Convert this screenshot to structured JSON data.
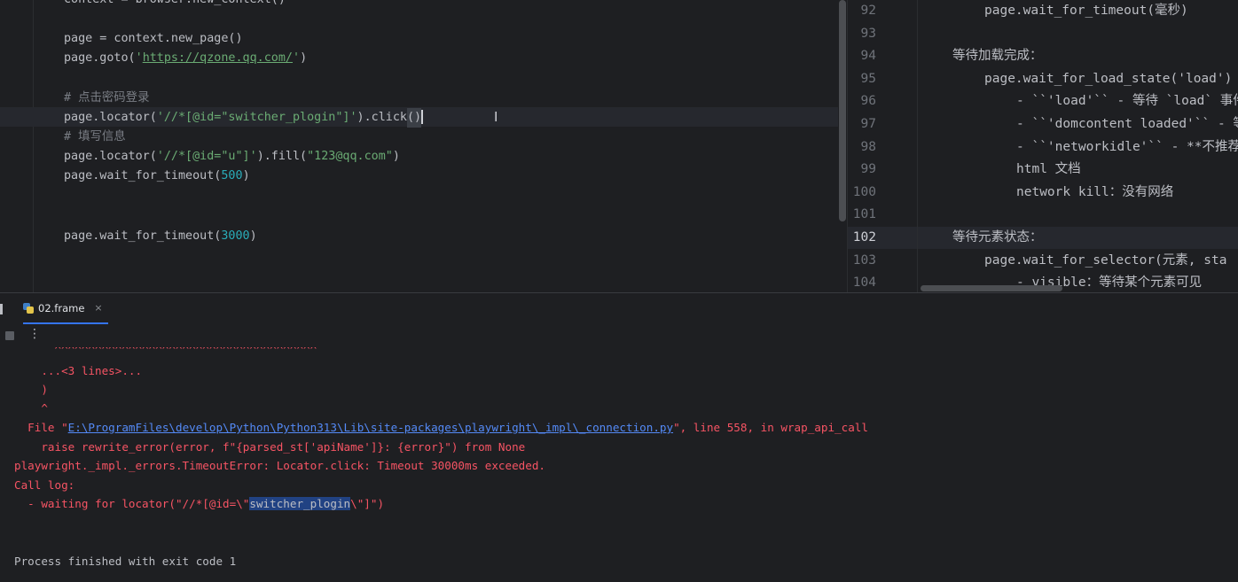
{
  "left_editor": {
    "lines": [
      {
        "parts": [
          {
            "t": "context = browser.new_context()",
            "c": ""
          }
        ]
      },
      {
        "parts": [
          {
            "t": "page = context.new_page()",
            "c": ""
          }
        ]
      },
      {
        "parts": [
          {
            "t": "page.goto(",
            "c": ""
          },
          {
            "t": "'",
            "c": "str"
          },
          {
            "t": "https://qzone.qq.com/",
            "c": "url"
          },
          {
            "t": "'",
            "c": "str"
          },
          {
            "t": ")",
            "c": ""
          }
        ]
      },
      {
        "parts": [
          {
            "t": "# 点击密码登录",
            "c": "cmt"
          }
        ]
      },
      {
        "parts": [
          {
            "t": "page.locator(",
            "c": ""
          },
          {
            "t": "'//*[@id=\"switcher_plogin\"]'",
            "c": "str"
          },
          {
            "t": ").click",
            "c": ""
          },
          {
            "t": "()",
            "c": "caret"
          }
        ]
      },
      {
        "parts": [
          {
            "t": "# 填写信息",
            "c": "cmt"
          }
        ]
      },
      {
        "parts": [
          {
            "t": "page.locator(",
            "c": ""
          },
          {
            "t": "'//*[@id=\"u\"]'",
            "c": "str"
          },
          {
            "t": ").fill(",
            "c": ""
          },
          {
            "t": "\"123@qq.com\"",
            "c": "str"
          },
          {
            "t": ")",
            "c": ""
          }
        ]
      },
      {
        "parts": [
          {
            "t": "page.wait_for_timeout(",
            "c": ""
          },
          {
            "t": "500",
            "c": "num"
          },
          {
            "t": ")",
            "c": ""
          }
        ]
      },
      {
        "parts": [
          {
            "t": "page.wait_for_timeout(",
            "c": ""
          },
          {
            "t": "3000",
            "c": "num"
          },
          {
            "t": ")",
            "c": ""
          }
        ]
      }
    ]
  },
  "right_editor": {
    "active_line": "102",
    "lines": [
      {
        "num": "92",
        "indent": 2,
        "text": "page.wait_for_timeout(毫秒)"
      },
      {
        "num": "93",
        "indent": 0,
        "text": ""
      },
      {
        "num": "94",
        "indent": 1,
        "text": "等待加载完成："
      },
      {
        "num": "95",
        "indent": 2,
        "text": "page.wait_for_load_state('load')"
      },
      {
        "num": "96",
        "indent": 3,
        "text": "- ``'load'`` - 等待 `load` 事件"
      },
      {
        "num": "97",
        "indent": 3,
        "text": "- ``'domcontent loaded'`` - 等"
      },
      {
        "num": "98",
        "indent": 3,
        "text": "- ``'networkidle'`` - **不推荐"
      },
      {
        "num": "99",
        "indent": 3,
        "text": "html 文档"
      },
      {
        "num": "100",
        "indent": 3,
        "text": "network kill：没有网络"
      },
      {
        "num": "101",
        "indent": 0,
        "text": ""
      },
      {
        "num": "102",
        "indent": 1,
        "text": "等待元素状态："
      },
      {
        "num": "103",
        "indent": 2,
        "text": "page.wait_for_selector(元素, sta"
      },
      {
        "num": "104",
        "indent": 3,
        "text": "- visible：等待某个元素可见"
      }
    ]
  },
  "tab": {
    "label": "02.frame",
    "close": "×"
  },
  "console": {
    "lines": [
      {
        "text": "      ^^^^^^^^^^^^^^^^^^^^^^^^^^^^^^^^^^^^^^^",
        "kind": "err"
      },
      {
        "text": "    ...<3 lines>...",
        "kind": "err"
      },
      {
        "text": "    )",
        "kind": "err"
      },
      {
        "text": "    ^",
        "kind": "err"
      },
      {
        "text": "  File \"",
        "kind": "file",
        "link": "E:\\ProgramFiles\\develop\\Python\\Python313\\Lib\\site-packages\\playwright\\_impl\\_connection.py",
        "after": "\", line 558, in wrap_api_call"
      },
      {
        "text": "    raise rewrite_error(error, f\"{parsed_st['apiName']}: {error}\") from None",
        "kind": "err"
      },
      {
        "text": "playwright._impl._errors.TimeoutError: Locator.click: Timeout 30000ms exceeded.",
        "kind": "err"
      },
      {
        "text": "Call log:",
        "kind": "err"
      },
      {
        "text": "  - waiting for locator(\"//*[@id=\\\"",
        "kind": "sel",
        "sel": "switcher_plogin",
        "after": "\\\"]\")"
      },
      {
        "text": "",
        "kind": "err"
      },
      {
        "text": "",
        "kind": "err"
      },
      {
        "text": "Process finished with exit code 1",
        "kind": "normal"
      }
    ]
  }
}
